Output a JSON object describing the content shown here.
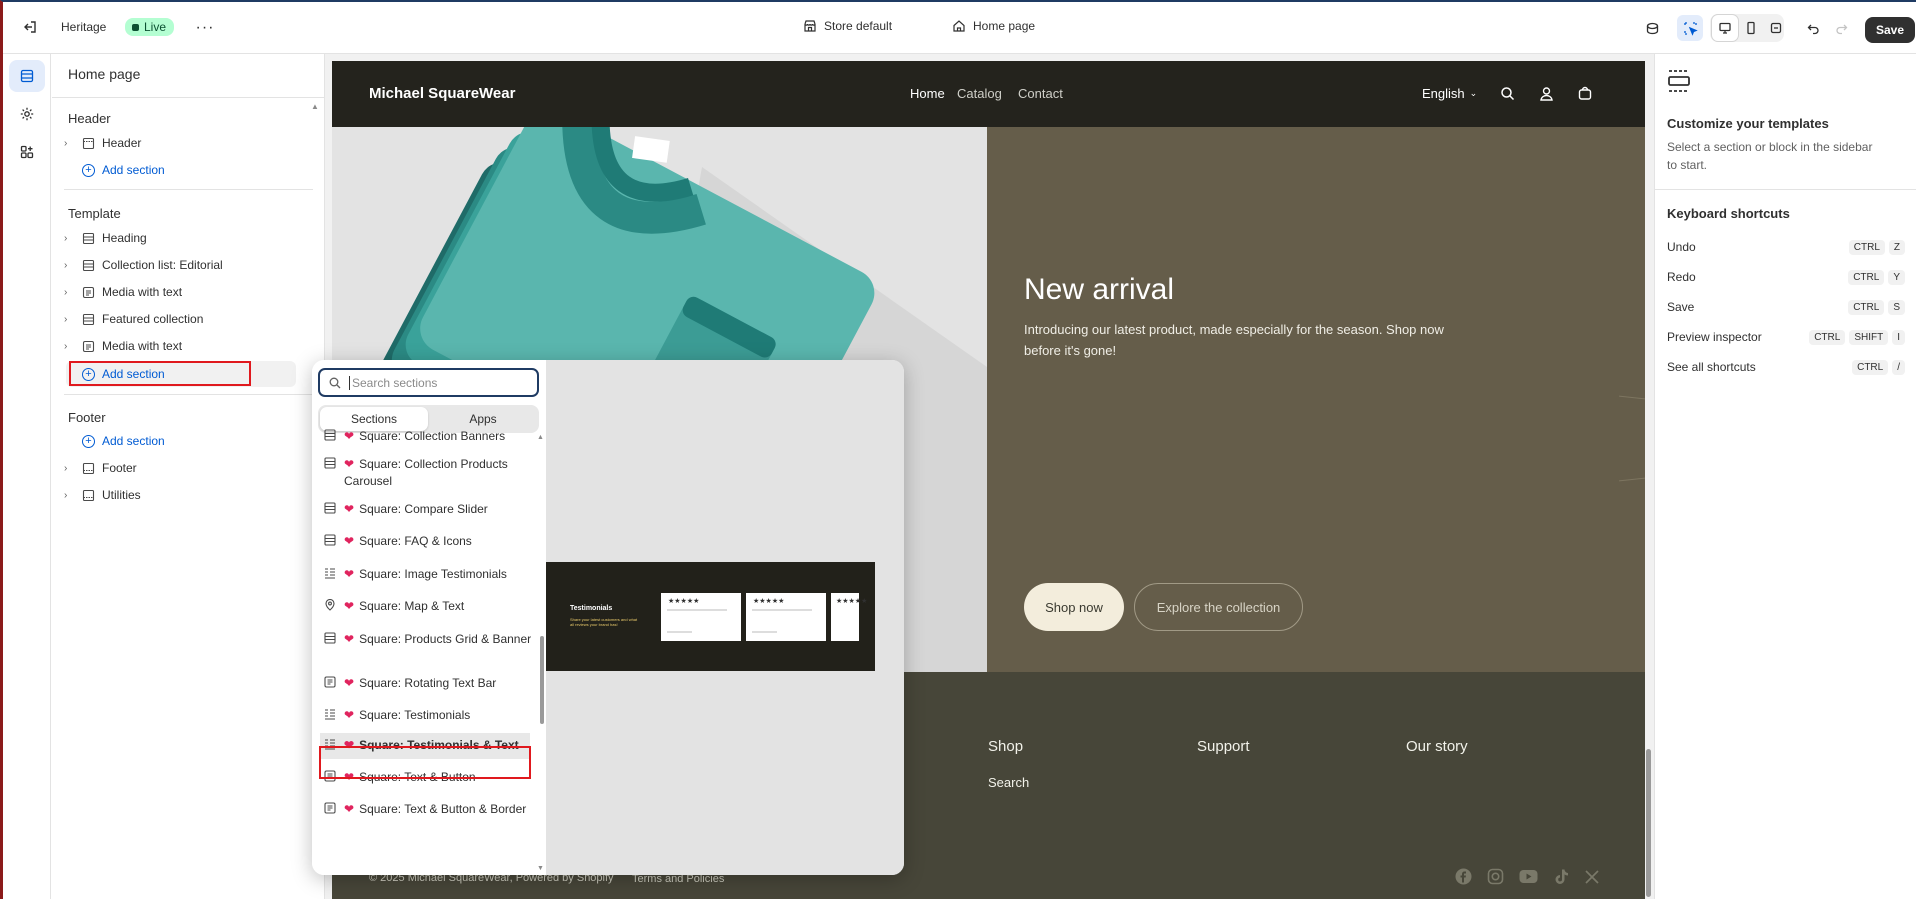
{
  "topbar": {
    "theme_name": "Heritage",
    "status": "Live",
    "store_selector": "Store default",
    "page_selector": "Home page",
    "save_label": "Save"
  },
  "sidebar": {
    "title": "Home page",
    "header_group": "Header",
    "header_items": [
      {
        "label": "Header"
      }
    ],
    "add_section": "Add section",
    "template_group": "Template",
    "template_items": [
      {
        "label": "Heading"
      },
      {
        "label": "Collection list: Editorial"
      },
      {
        "label": "Media with text"
      },
      {
        "label": "Featured collection"
      },
      {
        "label": "Media with text"
      }
    ],
    "footer_group": "Footer",
    "footer_items": [
      {
        "label": "Footer"
      },
      {
        "label": "Utilities"
      }
    ]
  },
  "store": {
    "brand": "Michael SquareWear",
    "nav": [
      "Home",
      "Catalog",
      "Contact"
    ],
    "language": "English",
    "hero_title": "New arrival",
    "hero_text": "Introducing our latest product, made especially for the season. Shop now before it's gone!",
    "btn_primary": "Shop now",
    "btn_secondary": "Explore the collection",
    "footer_cols": [
      "Shop",
      "Support",
      "Our story"
    ],
    "footer_link": "Search",
    "copyright": "© 2025 Michael SquareWear, Powered by Shopify",
    "terms": "Terms and Policies"
  },
  "popup": {
    "search_placeholder": "Search sections",
    "tab_sections": "Sections",
    "tab_apps": "Apps",
    "items": [
      {
        "label": "Square: Collection Banners",
        "icon": "layout-icon"
      },
      {
        "label": "Square: Collection Products Carousel",
        "icon": "layout-icon"
      },
      {
        "label": "Square: Compare Slider",
        "icon": "layout-icon"
      },
      {
        "label": "Square: FAQ & Icons",
        "icon": "layout-icon"
      },
      {
        "label": "Square: Image Testimonials",
        "icon": "list-icon"
      },
      {
        "label": "Square: Map & Text",
        "icon": "map-pin-icon"
      },
      {
        "label": "Square: Products Grid & Banner",
        "icon": "layout-icon"
      },
      {
        "label": "Square: Rotating Text Bar",
        "icon": "text-icon"
      },
      {
        "label": "Square: Testimonials",
        "icon": "list-icon"
      },
      {
        "label": "Square: Testimonials & Text",
        "icon": "list-icon"
      },
      {
        "label": "Square: Text & Button",
        "icon": "text-icon"
      },
      {
        "label": "Square: Text & Button & Border",
        "icon": "text-icon"
      }
    ],
    "preview_title": "Testimonials",
    "preview_subtitle": "Share your latest customers and what all reviews your brand has!",
    "preview_stars": "★★★★★"
  },
  "rpanel": {
    "title": "Customize your templates",
    "desc": "Select a section or block in the sidebar to start.",
    "shortcuts_title": "Keyboard shortcuts",
    "shortcuts": [
      {
        "label": "Undo",
        "keys": [
          "CTRL",
          "Z"
        ]
      },
      {
        "label": "Redo",
        "keys": [
          "CTRL",
          "Y"
        ]
      },
      {
        "label": "Save",
        "keys": [
          "CTRL",
          "S"
        ]
      },
      {
        "label": "Preview inspector",
        "keys": [
          "CTRL",
          "SHIFT",
          "I"
        ]
      },
      {
        "label": "See all shortcuts",
        "keys": [
          "CTRL",
          "/"
        ]
      }
    ]
  }
}
